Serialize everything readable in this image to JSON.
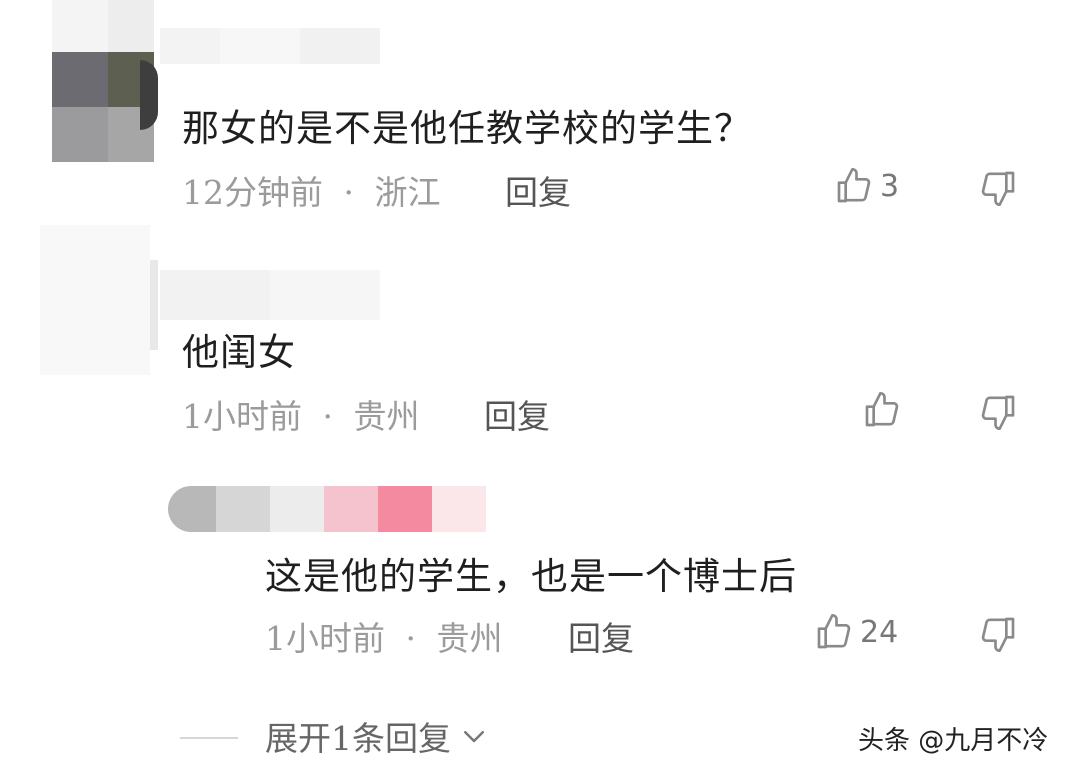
{
  "comments": [
    {
      "text": "那女的是不是他任教学校的学生？",
      "time": "12分钟前",
      "sep": "·",
      "location": "浙江",
      "reply_label": "回复",
      "likes": "3"
    },
    {
      "text": "他闺女",
      "time": "1小时前",
      "sep": "·",
      "location": "贵州",
      "reply_label": "回复",
      "likes": ""
    },
    {
      "text": "这是他的学生，也是一个博士后",
      "time": "1小时前",
      "sep": "·",
      "location": "贵州",
      "reply_label": "回复",
      "likes": "24"
    }
  ],
  "expand_replies": {
    "label": "展开1条回复"
  },
  "watermark": "头条 @九月不冷",
  "icons": {
    "like": "thumbs-up-icon",
    "dislike": "thumbs-down-icon",
    "expand": "chevron-down-icon"
  },
  "colors": {
    "text": "#1f1f1f",
    "meta": "#9b9b9b",
    "icon": "#8a8a8a",
    "blur_pink": "#f38aa0"
  }
}
